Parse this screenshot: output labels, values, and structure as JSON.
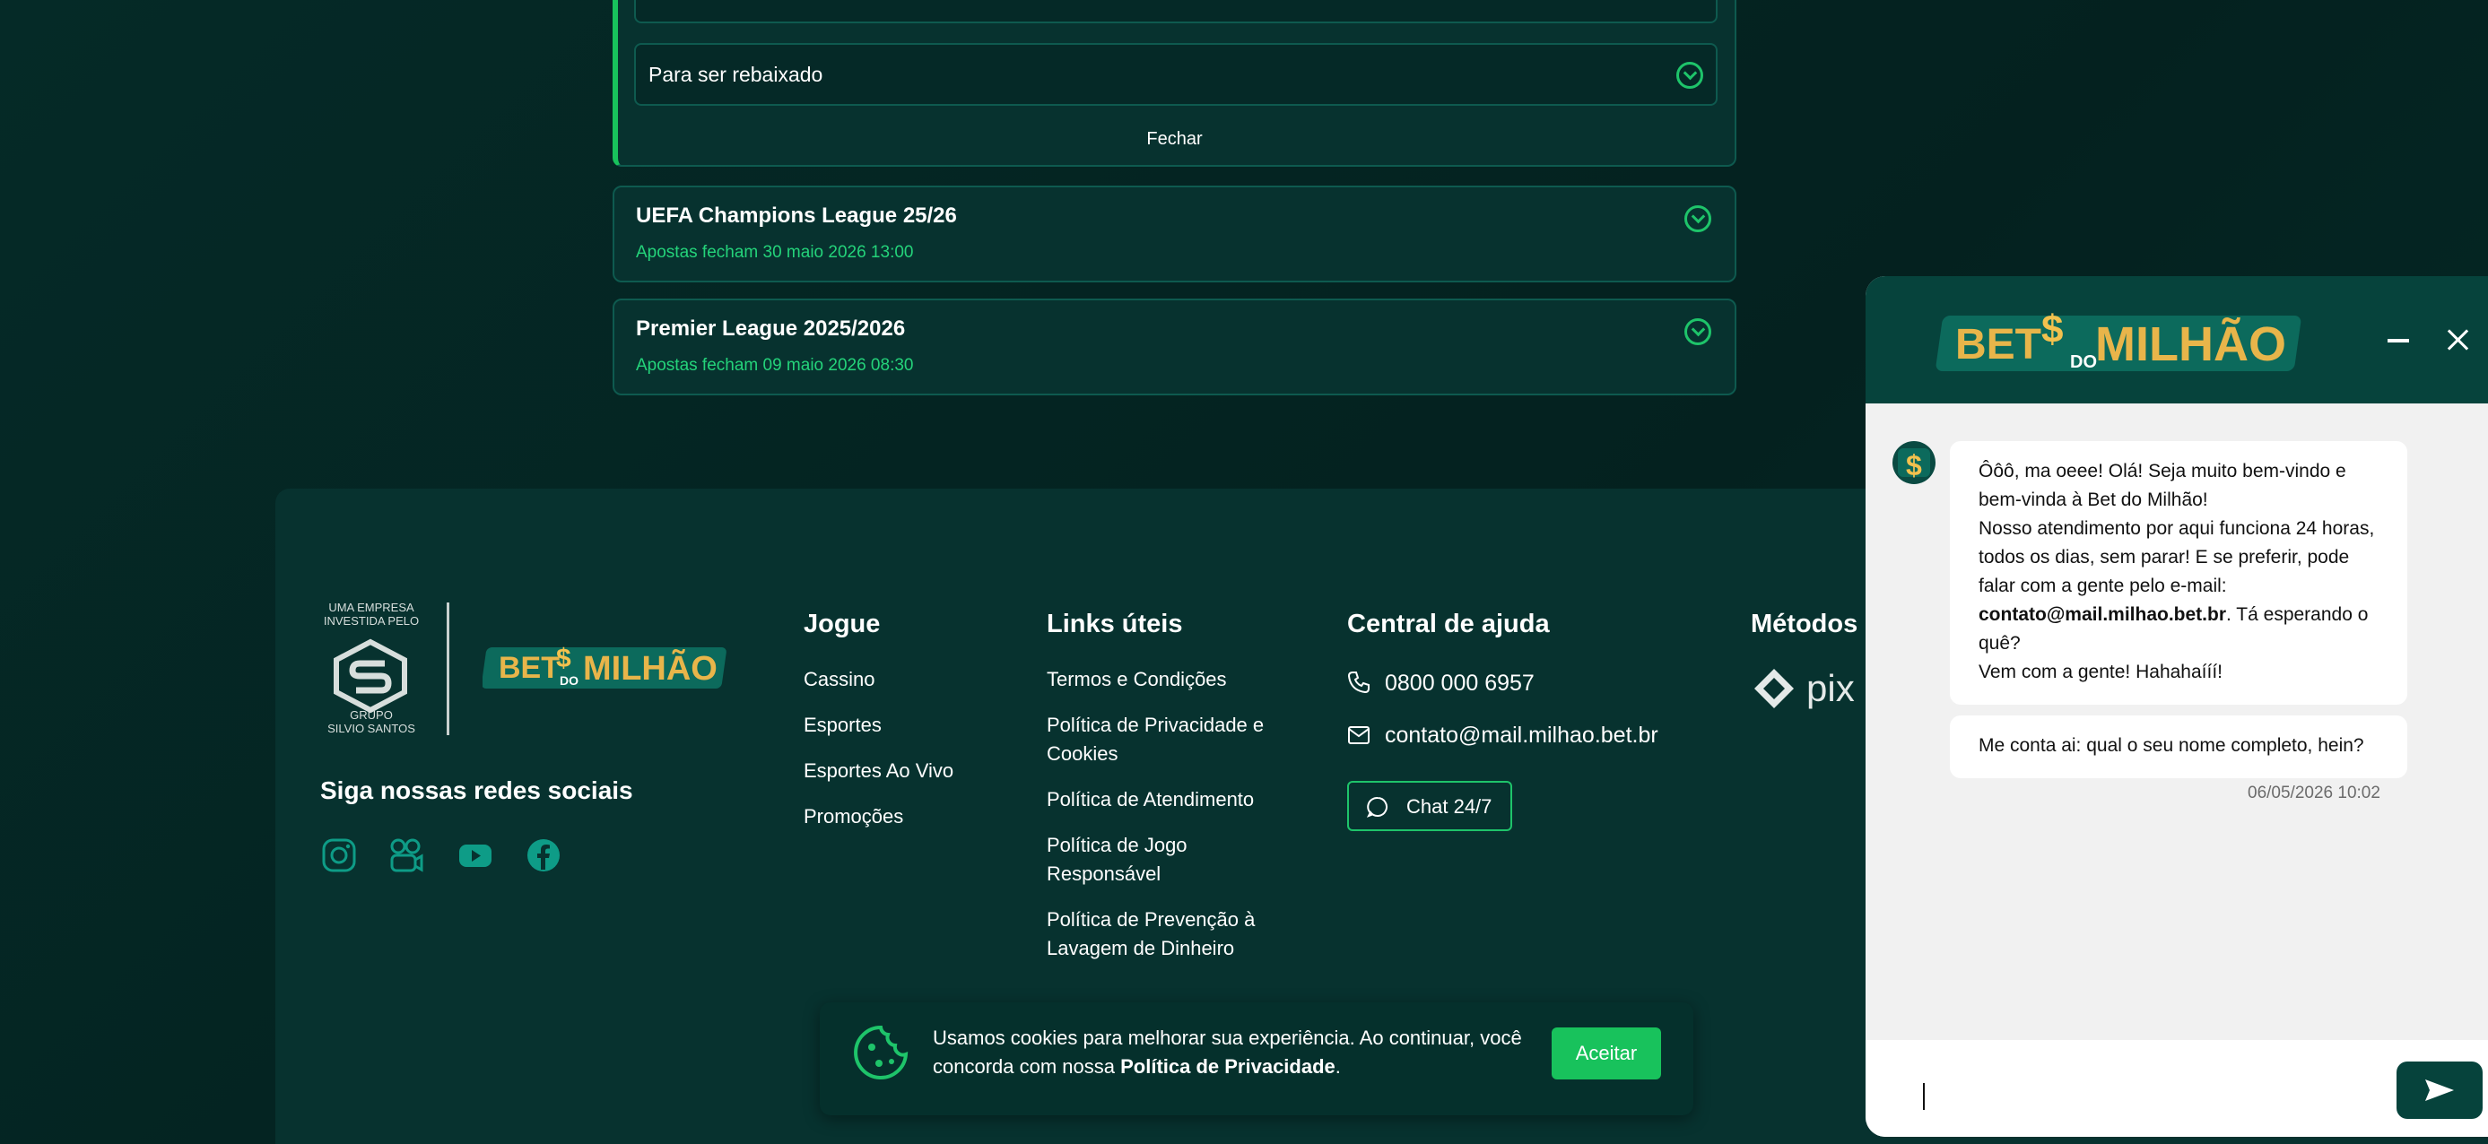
{
  "accordion": {
    "option_label": "Para ser rebaixado",
    "close_label": "Fechar"
  },
  "markets": [
    {
      "title": "UEFA Champions League 25/26",
      "subtitle": "Apostas fecham 30 maio 2026 13:00"
    },
    {
      "title": "Premier League 2025/2026",
      "subtitle": "Apostas fecham 09 maio 2026 08:30"
    }
  ],
  "footer": {
    "group_top": "UMA EMPRESA\nINVESTIDA PELO",
    "group_bottom": "GRUPO\nSILVIO SANTOS",
    "brand_logo_text": "BET DO MILHÃO",
    "social_title": "Siga nossas redes sociais",
    "social_icons": [
      "instagram-icon",
      "kwai-icon",
      "youtube-icon",
      "facebook-icon"
    ],
    "jogue": {
      "title": "Jogue",
      "links": [
        "Cassino",
        "Esportes",
        "Esportes Ao Vivo",
        "Promoções"
      ]
    },
    "links_uteis": {
      "title": "Links úteis",
      "links": [
        "Termos e Condições",
        "Política de Privacidade e Cookies",
        "Política de Atendimento",
        "Política de Jogo Responsável",
        "Política de Prevenção à Lavagem de Dinheiro"
      ]
    },
    "central": {
      "title": "Central de ajuda",
      "phone": "0800 000 6957",
      "email": "contato@mail.milhao.bet.br",
      "chat_label": "Chat 24/7"
    },
    "metodos": {
      "title": "Métodos d"
    }
  },
  "cookie": {
    "text_before": "Usamos cookies para melhorar sua experiência. Ao continuar, você concorda com nossa ",
    "link": "Política de Privacidade",
    "text_after": ".",
    "accept_label": "Aceitar"
  },
  "chat": {
    "logo_text": "BET DO MILHÃO",
    "messages": [
      {
        "lines": [
          "Ôôô, ma oeee! Olá! Seja muito bem-vindo e bem-vinda à Bet do Milhão!",
          "Nosso atendimento por aqui funciona 24 horas, todos os dias, sem parar! E se preferir, pode falar com a gente pelo e-mail:",
          "contato@mail.milhao.bet.br",
          ". Tá esperando o quê?",
          "Vem com a gente! Hahahaííí!"
        ]
      },
      {
        "lines": [
          "Me conta ai: qual o seu nome completo, hein?"
        ]
      }
    ],
    "timestamp": "06/05/2026 10:02"
  },
  "colors": {
    "background": "#04211f",
    "panel": "#07322f",
    "accent_green": "#18c25c",
    "chat_header": "#06433c"
  }
}
